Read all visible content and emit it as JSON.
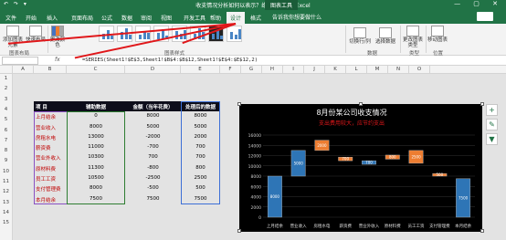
{
  "window": {
    "title": "收支情况分析如何以表示？绝了 1.xlsx  -  Excel",
    "context_tab": "图表工具",
    "quick_access": "↶ ↷ ▾",
    "controls": "— ▢ ✕"
  },
  "tabs": [
    "文件",
    "开始",
    "插入",
    "页面布局",
    "公式",
    "数据",
    "审阅",
    "视图",
    "开发工具",
    "帮助",
    "设计",
    "格式"
  ],
  "active_tab": "设计",
  "tell_me": "告诉我你想要做什么",
  "ribbon": {
    "add_element": "添加图表元素",
    "quick_layout": "快速布局",
    "change_colors": "更改颜色",
    "switch_row_col": "切换行/列",
    "select_data": "选择数据",
    "change_type": "更改图表类型",
    "move_chart": "移动图表",
    "groups": [
      "图表布局",
      "图表样式",
      "数据",
      "类型",
      "位置"
    ]
  },
  "formula_bar": {
    "fx": "fx",
    "formula": "=SERIES(Sheet1!$E$3,Sheet1!$B$4:$B$12,Sheet1!$E$4:$E$12,2)"
  },
  "columns": [
    "A",
    "B",
    "C",
    "D",
    "E",
    "F",
    "G",
    "H",
    "I",
    "J",
    "K",
    "L",
    "M",
    "N",
    "O"
  ],
  "rows": [
    "1",
    "2",
    "3",
    "4",
    "5",
    "6",
    "7",
    "8",
    "9",
    "10",
    "11",
    "12",
    "13",
    "14",
    "15"
  ],
  "table": {
    "headers": [
      "项  目",
      "辅助数据",
      "金额（当年花费）",
      "处理后的数据"
    ],
    "rows": [
      [
        "上月结余",
        "0",
        "8000",
        "8000"
      ],
      [
        "营业收入",
        "8000",
        "5000",
        "5000"
      ],
      [
        "房租水电",
        "13000",
        "-2000",
        "2000"
      ],
      [
        "薪资费",
        "11000",
        "-700",
        "700"
      ],
      [
        "营业外收入",
        "10300",
        "700",
        "700"
      ],
      [
        "原材料费",
        "11300",
        "-800",
        "800"
      ],
      [
        "员工工资",
        "10500",
        "-2500",
        "2500"
      ],
      [
        "支付管理费",
        "8000",
        "-500",
        "500"
      ],
      [
        "本月结余",
        "7500",
        "7500",
        "7500"
      ]
    ]
  },
  "chart_data": {
    "type": "bar",
    "title": "8月份某公司收支情况",
    "subtitle": "支出费用较大，应节约支出",
    "categories": [
      "上月结余",
      "营业收入",
      "房租水电",
      "薪资费",
      "营业外收入",
      "原材料费",
      "员工工资",
      "支付管理费",
      "本月结余"
    ],
    "base": [
      0,
      8000,
      13000,
      11000,
      10300,
      11300,
      10500,
      8000,
      0
    ],
    "values": [
      8000,
      5000,
      2000,
      700,
      700,
      800,
      2500,
      500,
      7500
    ],
    "colors": [
      "#2e75b6",
      "#2e75b6",
      "#ed7d31",
      "#ed7d31",
      "#2e75b6",
      "#ed7d31",
      "#ed7d31",
      "#ed7d31",
      "#2e75b6"
    ],
    "y_ticks": [
      "0",
      "2000",
      "4000",
      "6000",
      "8000",
      "10000",
      "12000",
      "14000",
      "16000"
    ],
    "ylim": [
      0,
      16000
    ],
    "grid": true
  },
  "chart_tools": [
    "+",
    "✎",
    "▼"
  ],
  "colors": {
    "accent": "#217346",
    "bar_up": "#2e75b6",
    "bar_down": "#ed7d31",
    "annotation": "#e0171a"
  }
}
